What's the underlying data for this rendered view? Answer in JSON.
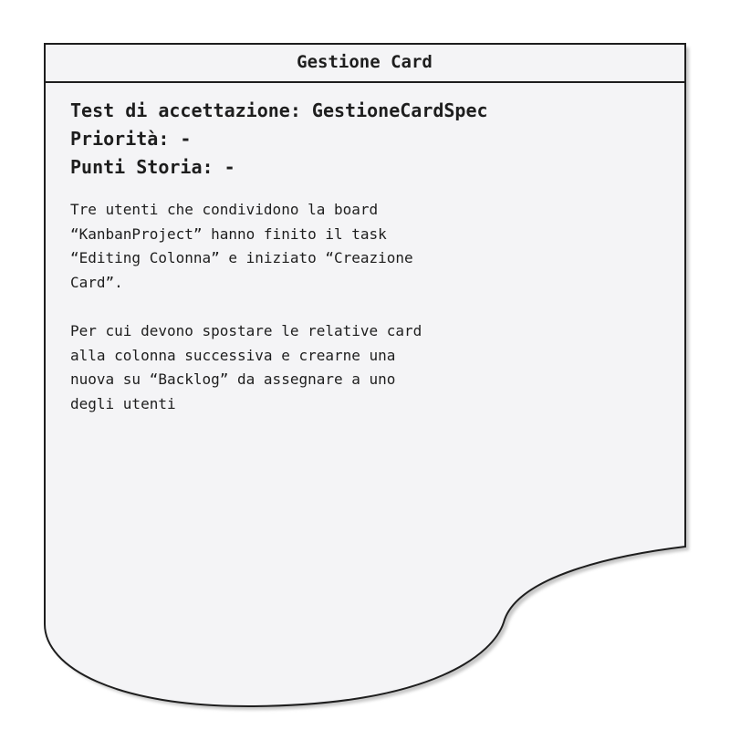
{
  "card": {
    "title": "Gestione Card",
    "acceptance_test": "Test di accettazione: GestioneCardSpec",
    "priority": "Priorità: -",
    "story_points": "Punti Storia: -",
    "description": [
      "Tre utenti che condividono la board\n“KanbanProject” hanno finito il task\n“Editing Colonna” e iniziato “Creazione\nCard”.",
      "Per cui devono spostare le relative card\nalla colonna successiva e crearne una\nnuova su “Backlog” da assegnare a uno\ndegli utenti"
    ]
  },
  "colors": {
    "card_fill": "#f4f4f6",
    "card_stroke": "#1e1e1e",
    "shadow": "#9a9a9a"
  }
}
